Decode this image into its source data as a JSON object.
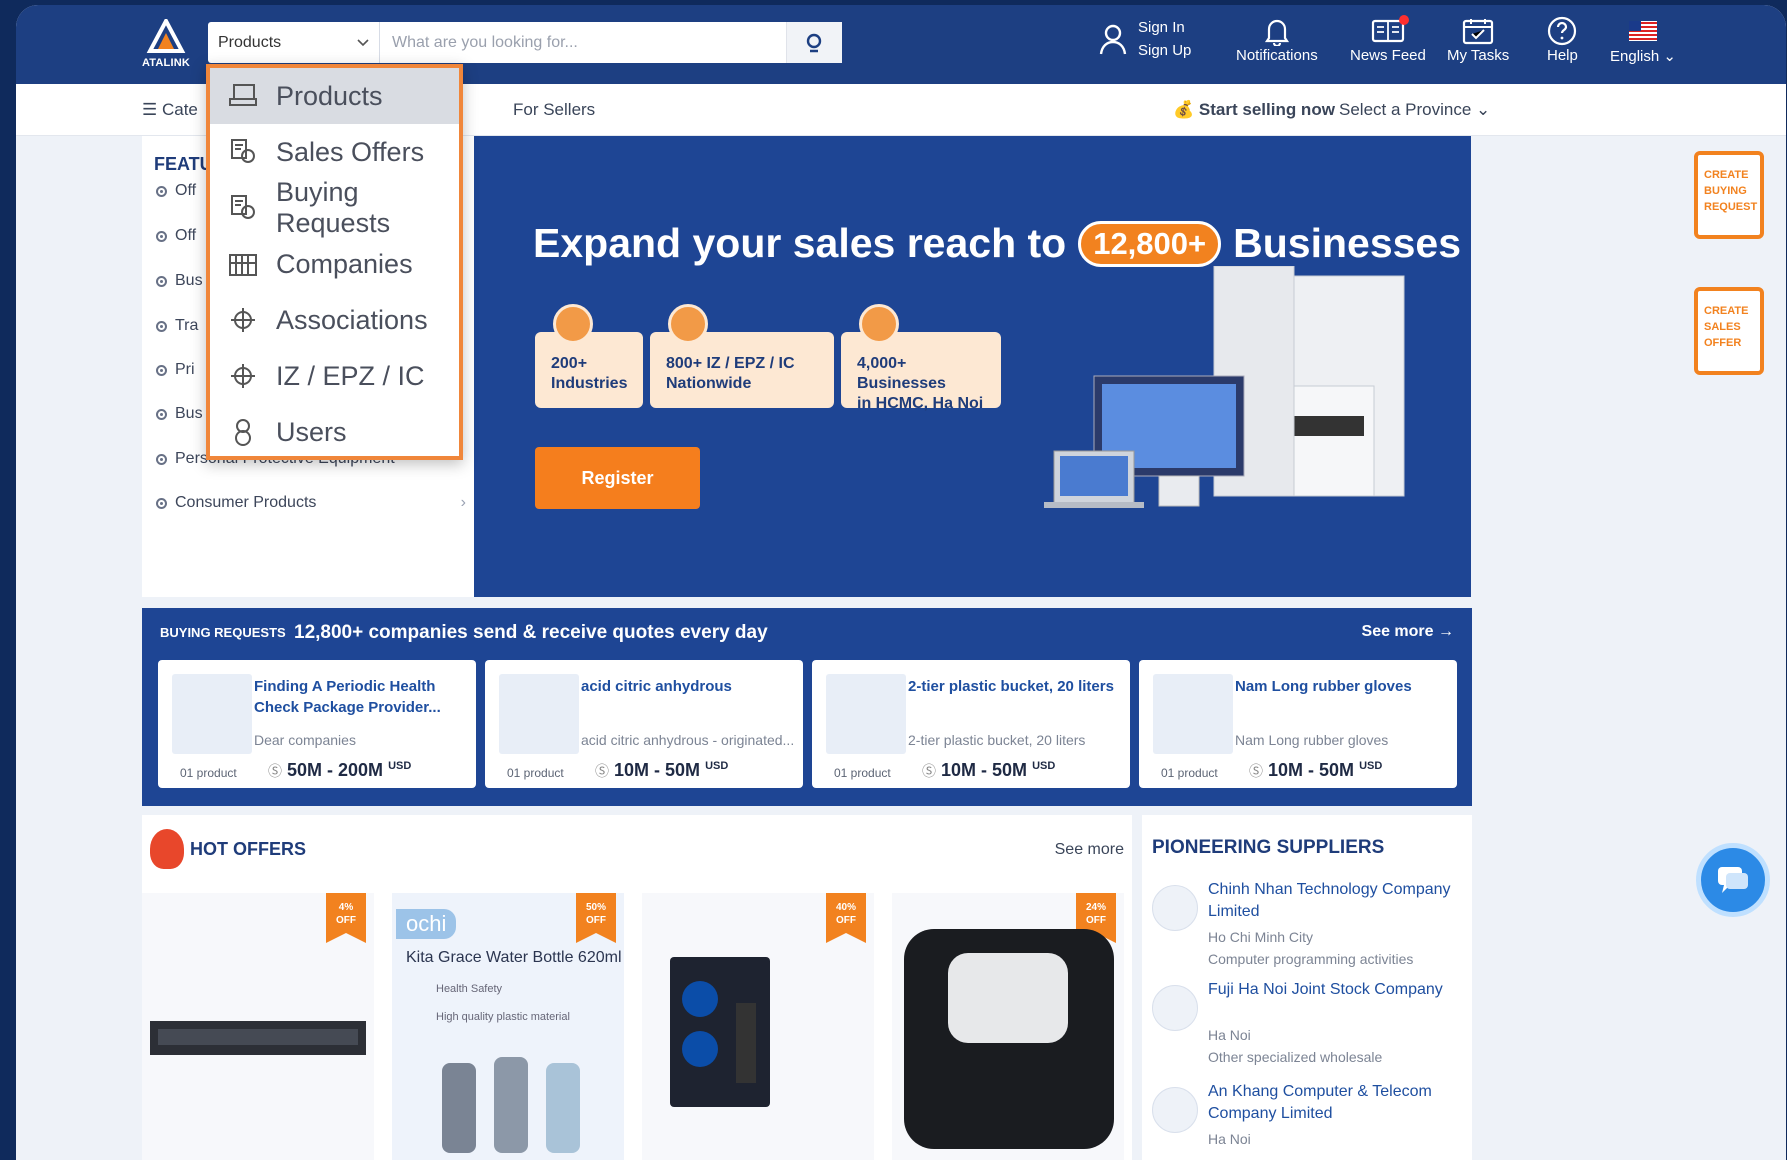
{
  "brand": {
    "name": "ATALINK"
  },
  "search": {
    "category": "Products",
    "placeholder": "What are you looking for..."
  },
  "header": {
    "sign_in": "Sign In",
    "sign_up": "Sign Up",
    "notifications": "Notifications",
    "news_feed": "News Feed",
    "my_tasks": "My Tasks",
    "help": "Help",
    "language": "English"
  },
  "subnav": {
    "categories": "Cate",
    "for_sellers": "For Sellers",
    "start_selling": "Start selling now",
    "select_province": "Select a Province"
  },
  "dropdown": {
    "items": [
      {
        "label": "Products",
        "icon": "products-icon"
      },
      {
        "label": "Sales Offers",
        "icon": "sales-offers-icon"
      },
      {
        "label": "Buying Requests",
        "icon": "buying-requests-icon"
      },
      {
        "label": "Companies",
        "icon": "companies-icon"
      },
      {
        "label": "Associations",
        "icon": "associations-icon"
      },
      {
        "label": "IZ / EPZ / IC",
        "icon": "iz-icon"
      },
      {
        "label": "Users",
        "icon": "users-icon"
      }
    ]
  },
  "sidebar": {
    "title": "FEATU",
    "items": [
      "Off",
      "Off",
      "Bus",
      "Tra",
      "Pri",
      "Bus",
      "Personal Protective Equipment",
      "Consumer Products"
    ]
  },
  "banner": {
    "title_pre": "Expand your sales reach to",
    "title_count": "12,800+",
    "title_post": "Businesses",
    "stats": [
      "200+\nIndustries",
      "800+ IZ / EPZ / IC\nNationwide",
      "4,000+ Businesses\nin HCMC, Ha Noi"
    ],
    "register": "Register"
  },
  "buying_requests": {
    "label": "BUYING REQUESTS",
    "tagline": "12,800+ companies send & receive quotes every day",
    "see_more": "See more →",
    "cards": [
      {
        "title": "Finding A Periodic Health Check Package Provider...",
        "desc": "Dear companies",
        "qty": "01 product",
        "price": "50M - 200M",
        "currency": "USD"
      },
      {
        "title": "acid citric anhydrous",
        "desc": "acid citric anhydrous - originated...",
        "qty": "01 product",
        "price": "10M - 50M",
        "currency": "USD"
      },
      {
        "title": "2-tier plastic bucket, 20 liters",
        "desc": "2-tier plastic bucket, 20 liters",
        "qty": "01 product",
        "price": "10M - 50M",
        "currency": "USD"
      },
      {
        "title": "Nam Long rubber gloves",
        "desc": "Nam Long rubber gloves",
        "qty": "01 product",
        "price": "10M - 50M",
        "currency": "USD"
      }
    ]
  },
  "hot_offers": {
    "title": "HOT OFFERS",
    "see_more": "See more",
    "products": [
      {
        "discount": "4%\nOFF",
        "caption": ""
      },
      {
        "discount": "50%\nOFF",
        "caption": "Kita Grace Water Bottle 620ml",
        "brand": "ochi",
        "f1": "Health Safety",
        "f2": "High quality plastic material"
      },
      {
        "discount": "40%\nOFF",
        "caption": ""
      },
      {
        "discount": "24%\nOFF",
        "caption": ""
      }
    ]
  },
  "pioneering": {
    "title": "PIONEERING SUPPLIERS",
    "suppliers": [
      {
        "name": "Chinh Nhan Technology Company Limited",
        "city": "Ho Chi Minh City",
        "activity": "Computer programming activities"
      },
      {
        "name": "Fuji Ha Noi Joint Stock Company",
        "city": "Ha Noi",
        "activity": "Other specialized wholesale"
      },
      {
        "name": "An Khang Computer & Telecom Company Limited",
        "city": "Ha Noi",
        "activity": ""
      }
    ]
  },
  "floats": {
    "create_buying": "CREATE\nBUYING\nREQUEST",
    "create_sales": "CREATE\nSALES\nOFFER"
  },
  "colors": {
    "navy": "#1d3f82",
    "banner": "#1e4594",
    "accent": "#f2821f"
  }
}
